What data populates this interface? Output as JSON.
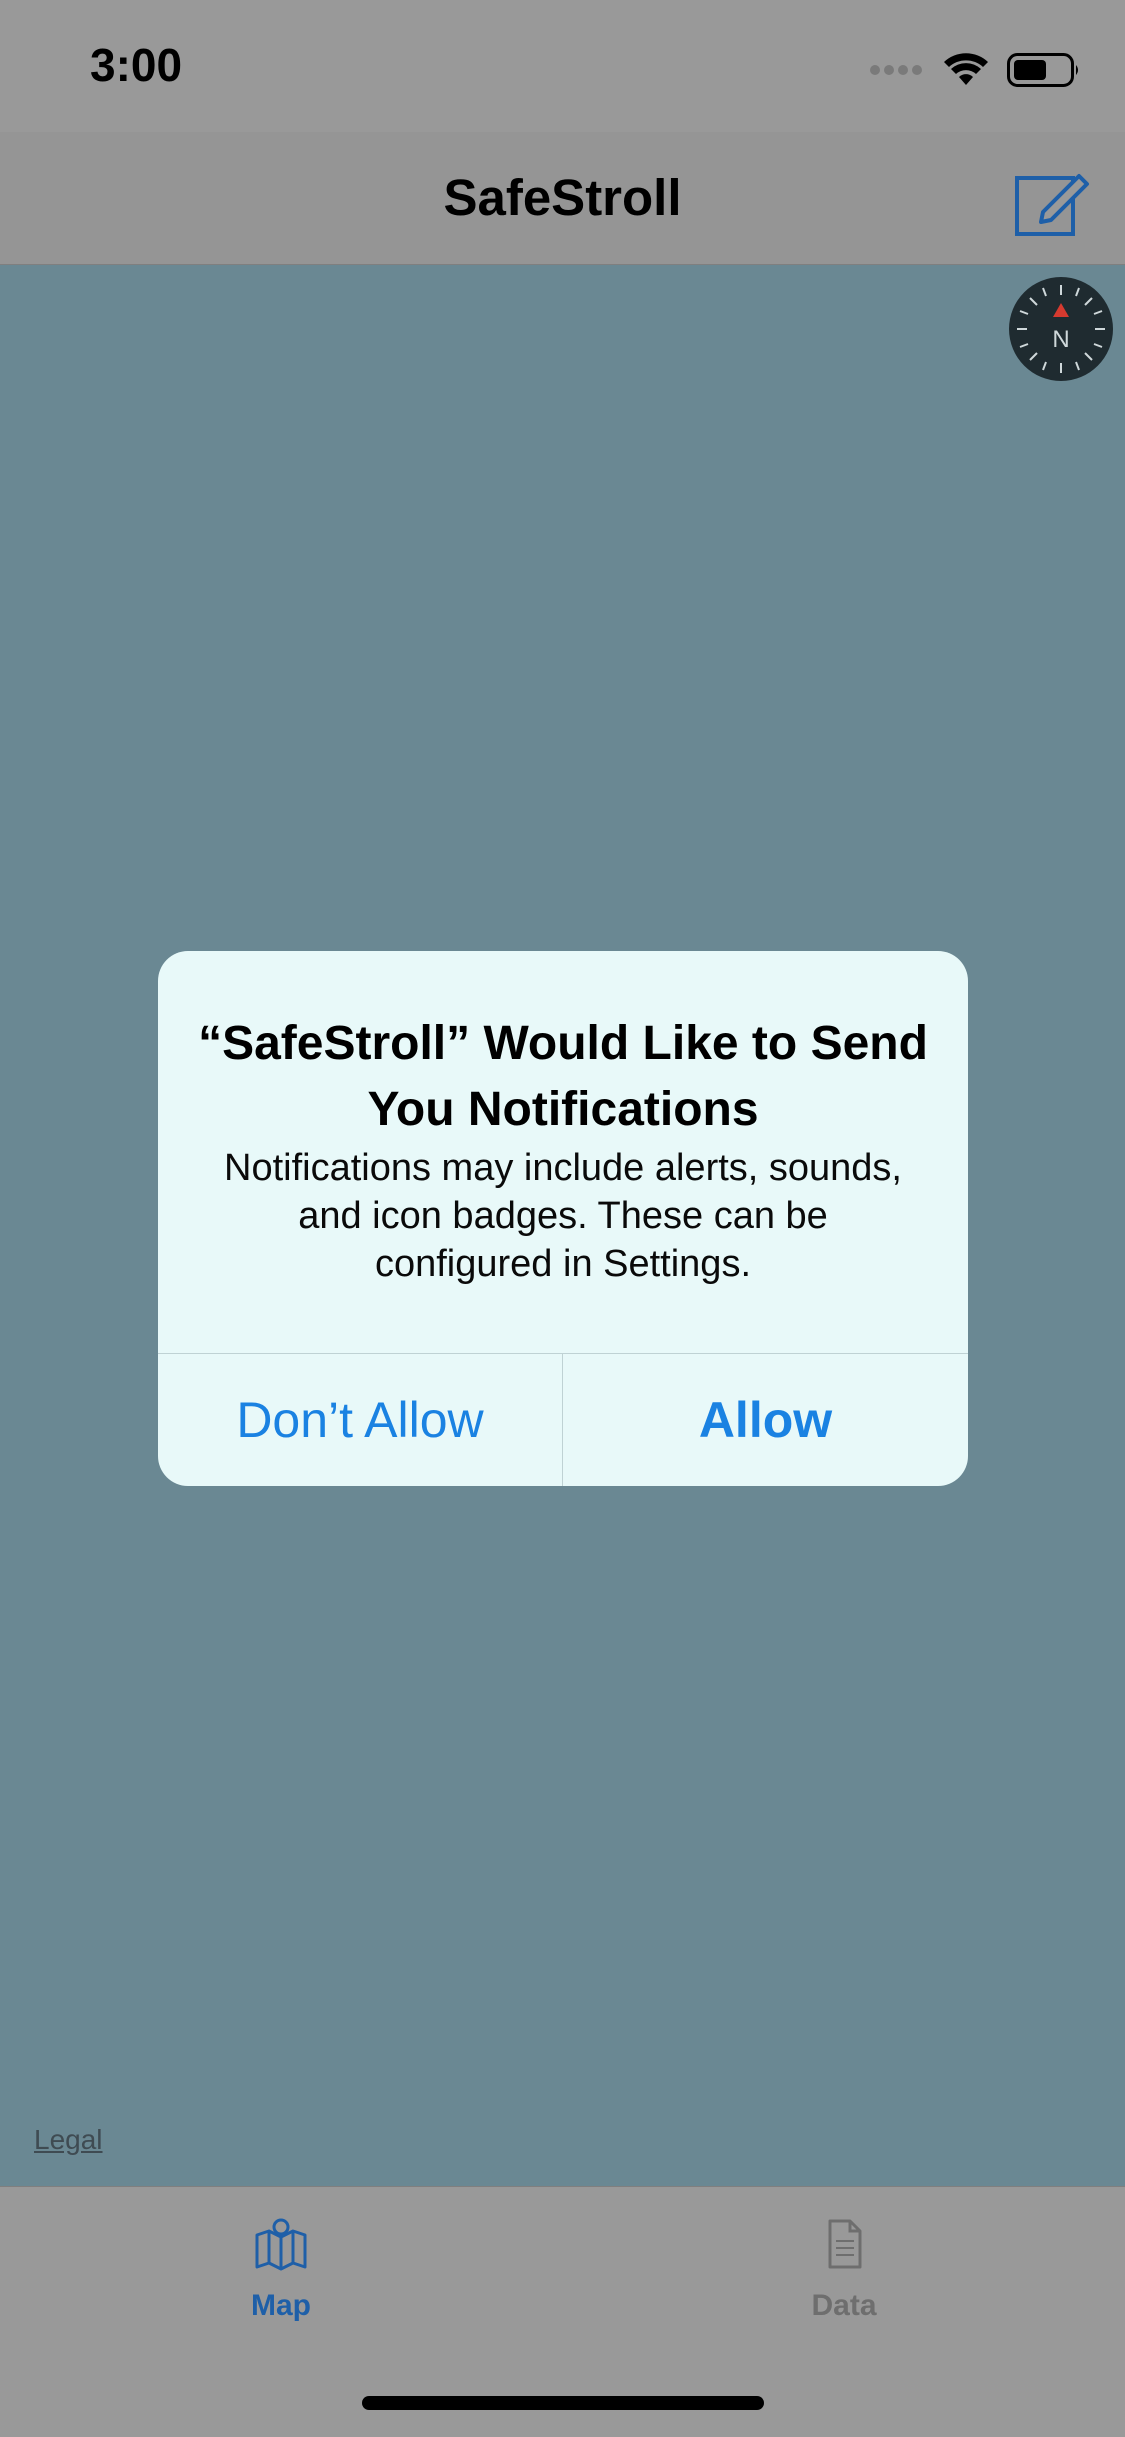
{
  "status_bar": {
    "time": "3:00",
    "icons": [
      "cellular-signal-icon",
      "wifi-icon",
      "battery-icon"
    ]
  },
  "nav_bar": {
    "title": "SafeStroll",
    "edit_icon": "compose-icon"
  },
  "map": {
    "compass_label": "N",
    "legal_link": "Legal"
  },
  "alert": {
    "title": "“SafeStroll” Would Like to Send You Notifications",
    "message": "Notifications may include alerts, sounds, and icon badges. These can be configured in Settings.",
    "deny_label": "Don’t Allow",
    "allow_label": "Allow"
  },
  "tab_bar": {
    "tabs": [
      {
        "label": "Map",
        "icon": "map-icon",
        "selected": true
      },
      {
        "label": "Data",
        "icon": "document-icon",
        "selected": false
      }
    ]
  },
  "colors": {
    "accent": "#1a82e2",
    "map_background": "#6a8893",
    "alert_background": "#e8f9f9",
    "dim_overlay": "#999999"
  }
}
